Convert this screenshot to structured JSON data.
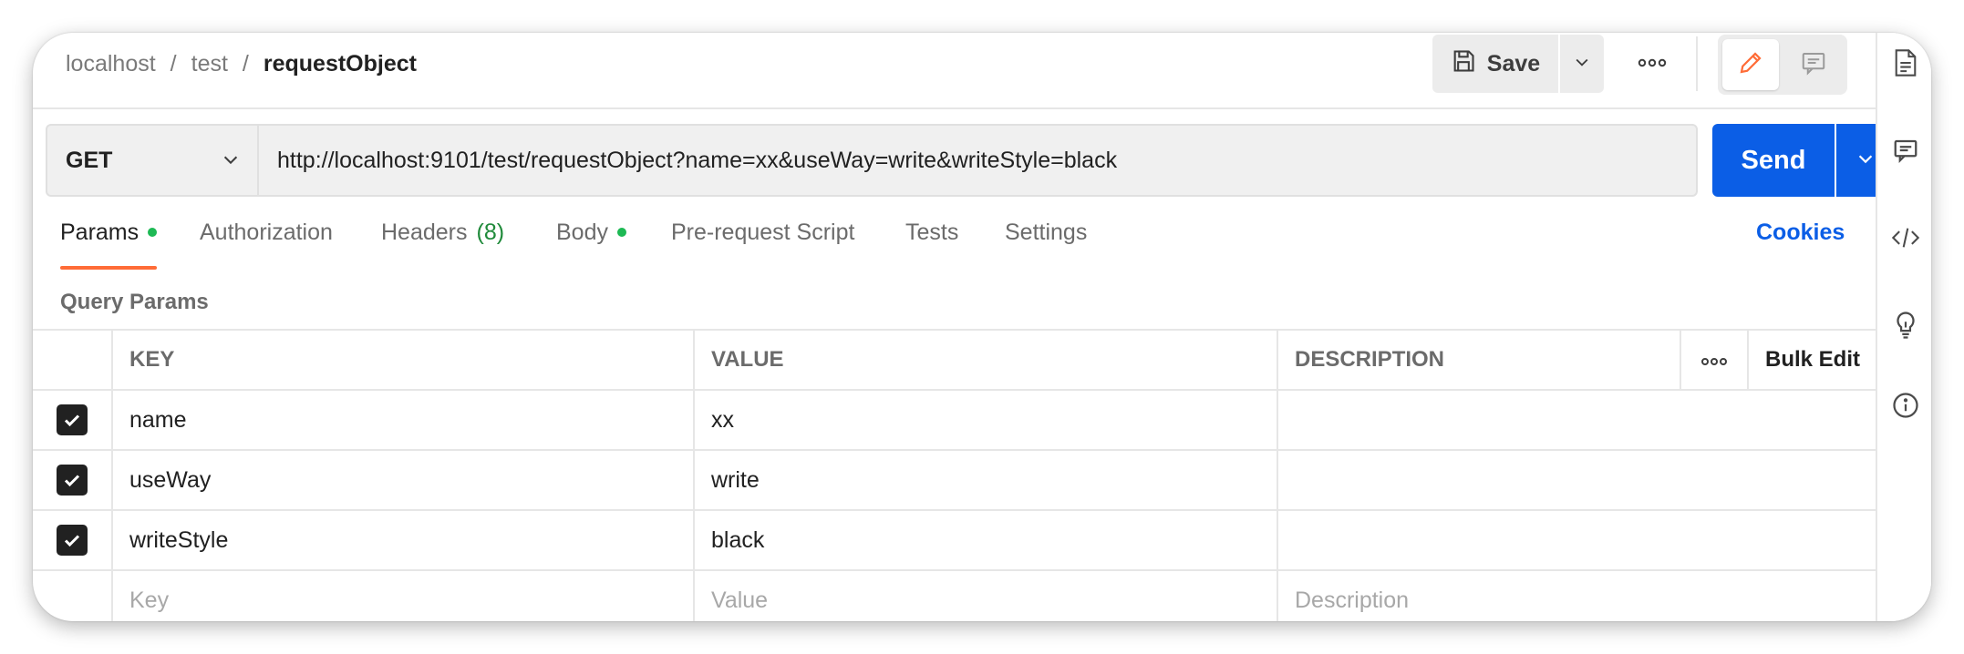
{
  "breadcrumb": {
    "items": [
      "localhost",
      "test"
    ],
    "separator": "/",
    "current": "requestObject"
  },
  "header": {
    "save_label": "Save",
    "save_icon": "floppy-disk-icon",
    "more_icon": "ellipsis-icon",
    "edit_icon": "pencil-icon",
    "comment_icon": "comment-icon"
  },
  "request": {
    "method": "GET",
    "url": "http://localhost:9101/test/requestObject?name=xx&useWay=write&writeStyle=black",
    "send_label": "Send"
  },
  "tabs": {
    "params": "Params",
    "authorization": "Authorization",
    "headers": "Headers",
    "headers_count": "(8)",
    "body": "Body",
    "prerequest": "Pre-request Script",
    "tests": "Tests",
    "settings": "Settings",
    "cookies": "Cookies"
  },
  "query_params": {
    "label": "Query Params",
    "columns": {
      "key": "KEY",
      "value": "VALUE",
      "description": "DESCRIPTION",
      "bulk_edit": "Bulk Edit"
    },
    "rows": [
      {
        "checked": true,
        "key": "name",
        "value": "xx",
        "description": ""
      },
      {
        "checked": true,
        "key": "useWay",
        "value": "write",
        "description": ""
      },
      {
        "checked": true,
        "key": "writeStyle",
        "value": "black",
        "description": ""
      }
    ],
    "placeholders": {
      "key": "Key",
      "value": "Value",
      "description": "Description"
    }
  },
  "right_rail": {
    "icons": [
      "document-icon",
      "comment-icon",
      "code-icon",
      "lightbulb-icon",
      "info-icon"
    ]
  },
  "colors": {
    "send": "#0b5ee6",
    "active_tab_underline": "#ff6c37",
    "status_dot": "#1db954",
    "headers_count": "#1f8a3a",
    "cookies": "#0b5ee6"
  }
}
